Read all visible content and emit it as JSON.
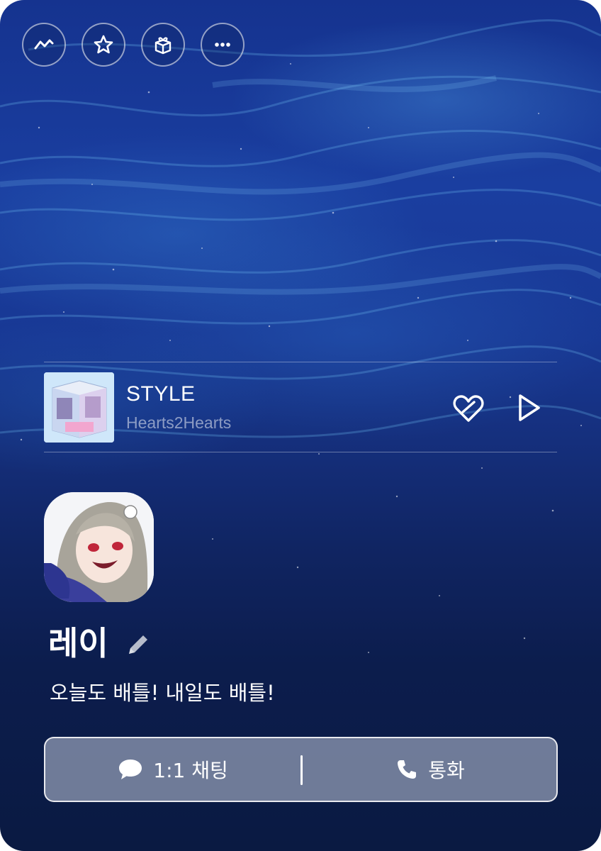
{
  "toolbar": {
    "icons": [
      "chart-icon",
      "star-icon",
      "gift-box-icon",
      "more-icon"
    ]
  },
  "music": {
    "title": "STYLE",
    "artist": "Hearts2Hearts",
    "album_art": "album-cover-thumbnail",
    "like_icon": "heart-icon",
    "play_icon": "play-icon"
  },
  "profile": {
    "name": "레이",
    "status": "오늘도 배틀! 내일도 배틀!"
  },
  "actions": {
    "chat_label": "1:1 채팅",
    "call_label": "통화"
  },
  "colors": {
    "background_top": "#1a3ea0",
    "background_bottom": "#0a1a42",
    "action_bar": "#8c96af",
    "text": "#ffffff"
  }
}
